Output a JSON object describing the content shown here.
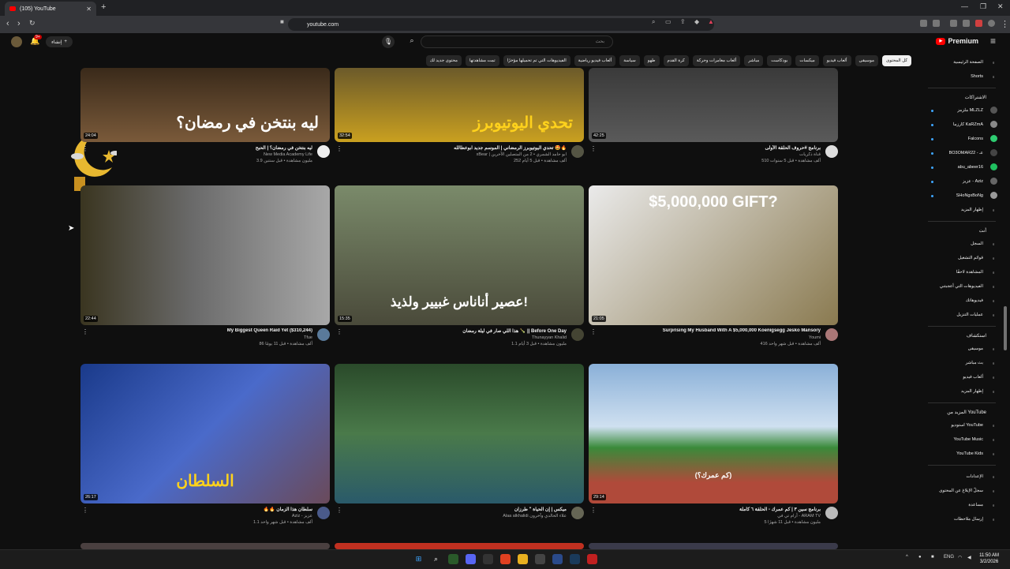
{
  "browser": {
    "tab_title": "(105) YouTube",
    "new_tab": "+",
    "url": "youtube.com",
    "win_controls": [
      "—",
      "❐",
      "✕"
    ]
  },
  "header": {
    "logo": "Premium",
    "search_placeholder": "بحث",
    "create_label": "إنشاء",
    "notif_count": "9+"
  },
  "chips": [
    {
      "label": "كل المحتوى",
      "active": true
    },
    {
      "label": "موسيقى"
    },
    {
      "label": "ألعاب فيديو"
    },
    {
      "label": "ميكسات"
    },
    {
      "label": "بودكاست"
    },
    {
      "label": "مباشر"
    },
    {
      "label": "ألعاب مغامرات وحركة"
    },
    {
      "label": "كرة القدم"
    },
    {
      "label": "طهو"
    },
    {
      "label": "سياسة"
    },
    {
      "label": "ألعاب فيديو رياضية"
    },
    {
      "label": "الفيديوهات التي تم تحميلها مؤخرًا"
    },
    {
      "label": "تمت مشاهدتها"
    },
    {
      "label": "محتوى جديد لك"
    }
  ],
  "sidebar": {
    "main": [
      {
        "label": "الصفحة الرئيسية",
        "icon": "home-icon"
      },
      {
        "label": "Shorts",
        "icon": "shorts-icon"
      }
    ],
    "subs_title": "الاشتراكات",
    "subs": [
      {
        "label": "ملزمز MLZLZ",
        "color": "#555"
      },
      {
        "label": "كارزما KaRZmA",
        "color": "#888"
      },
      {
        "label": "Falcons",
        "color": "#2ecc71"
      },
      {
        "label": "BO3OMAR22 - عـ",
        "color": "#444"
      },
      {
        "label": "abu_abeer16",
        "color": "#20c060"
      },
      {
        "label": "عزيز - Aziz",
        "color": "#666"
      },
      {
        "label": "SHoNgxBoNg",
        "color": "#999"
      }
    ],
    "subs_more": "إظهار المزيد",
    "you_title": "أنت",
    "you": [
      {
        "label": "السجل",
        "icon": "history-icon"
      },
      {
        "label": "قوائم التشغيل",
        "icon": "playlist-icon"
      },
      {
        "label": "المشاهدة لاحقًا",
        "icon": "clock-icon"
      },
      {
        "label": "الفيديوهات التي أعجبتني",
        "icon": "like-icon"
      },
      {
        "label": "فيديوهاتك",
        "icon": "video-icon"
      },
      {
        "label": "عمليات التنزيل",
        "icon": "download-icon"
      }
    ],
    "explore_title": "استكشاف",
    "explore": [
      {
        "label": "موسيقى",
        "icon": "music-icon"
      },
      {
        "label": "بث مباشر",
        "icon": "live-icon"
      },
      {
        "label": "ألعاب فيديو",
        "icon": "gaming-icon"
      },
      {
        "label": "إظهار المزيد",
        "icon": "chevron-down-icon"
      }
    ],
    "more_title": "المزيد من YouTube",
    "more": [
      {
        "label": "استوديو YouTube",
        "icon": "studio-icon"
      },
      {
        "label": "YouTube Music",
        "icon": "ytmusic-icon"
      },
      {
        "label": "YouTube Kids",
        "icon": "ytkids-icon"
      }
    ],
    "settings": [
      {
        "label": "الإعدادات",
        "icon": "gear-icon"
      },
      {
        "label": "سجلّ الإبلاغ عن المحتوى",
        "icon": "flag-icon"
      },
      {
        "label": "مساعدة",
        "icon": "help-icon"
      },
      {
        "label": "إرسال ملاحظات",
        "icon": "feedback-icon"
      }
    ]
  },
  "videos": [
    {
      "title": "برنامج #حروف الحلقة الأولى",
      "channel": "قناة ذكريات",
      "stats": "510 ألف مشاهدة • قبل 5 سنوات",
      "duration": "42:25",
      "thumb_text": "",
      "bg": "linear-gradient(180deg,#3a3a3a,#5a5a5a)",
      "accent": "#e8c020"
    },
    {
      "title": "تحدي اليوتيوبرز الرمضاني | الموسم جديد ابوعطالله 🤩🔥",
      "channel": "xBear | ابو حامد الشمري • 2 من المتصلين الآخرين",
      "stats": "252 ألف مشاهدة • قبل 5 أيام",
      "duration": "32:54",
      "thumb_text": "تحدي اليوتيوبرز",
      "bg": "linear-gradient(180deg,#6b5a2a,#c9a020)",
      "accent": "#ffd21c"
    },
    {
      "title": "ليه بنتخن في رمضان؟ | الحبح",
      "channel": "New Media Academy Life",
      "stats": "3.9 مليون مشاهدة • قبل سنتين",
      "duration": "24:04",
      "thumb_text": "ليه بنتخن في رمضان؟",
      "bg": "linear-gradient(180deg,#3a2a1a,#7a5a3a)",
      "accent": "#ffffff"
    },
    {
      "title": "Surprising My Husband With A $5,000,000 Koenigsegg Jesko Mansory",
      "channel": "Youmi",
      "stats": "416 ألف مشاهدة • قبل شهر واحد",
      "duration": "21:05",
      "thumb_text": "$5,000,000 GIFT?",
      "bg": "linear-gradient(135deg,#eaeaea,#8a7a50)",
      "accent": "#ffffff"
    },
    {
      "title": "هذا اللي صار في ليلة رمضان 🍾 || Before One Day",
      "channel": "Thunayyan Khalid",
      "stats": "1.1 مليون مشاهدة • قبل 3 أيام",
      "duration": "15:35",
      "thumb_text": "عصير أناناس غبيير ولذيذ!",
      "bg": "linear-gradient(180deg,#7a8a6a,#4a4a3a)",
      "accent": "#ffffff"
    },
    {
      "title": "My Biggest Queen Raid Yet ($310,244)",
      "channel": "Tfue",
      "stats": "86 ألف مشاهدة • قبل 11 يومًا",
      "duration": "22:44",
      "thumb_text": "",
      "bg": "linear-gradient(90deg,#3a3520,#6a6a6a 45%,#a8a8a8)",
      "accent": "#ffffff"
    },
    {
      "title": "برنامج سين ٣ | كم عمرك - الحلقة ٦ كاملة",
      "channel": "أرام تي في - ARAM TV",
      "stats": "5 مليون مشاهدة • قبل 11 شهرًا",
      "duration": "29:14",
      "thumb_text": "(كم عمرك؟)",
      "bg": "linear-gradient(180deg,#8ab0d8 0%,#cfe0f0 45%,#3a8a3a 60%,#b04a3a 85%)",
      "accent": "#ffffff"
    },
    {
      "title": "ميكس | إن الحياة \" طرزان",
      "channel": "Alaa alkhalidi علاء الخالدي وآخرون",
      "stats": "",
      "duration": "",
      "thumb_text": "",
      "bg": "linear-gradient(180deg,#2a4a2a,#4a7a4a 50%,#2a5a6a)",
      "accent": "#ffffff"
    },
    {
      "title": "🔥🔥 سلطان هذا الزمان",
      "channel": "Aziz - عزيز",
      "stats": "1.1 ألف مشاهدة • قبل شهر واحد",
      "duration": "26:17",
      "thumb_text": "السلطان",
      "bg": "linear-gradient(135deg,#1a3a8a,#4a6aca 50%,#6a4a5a)",
      "accent": "#ffd21c"
    }
  ],
  "taskbar": {
    "lang": "ENG",
    "time": "11:50 AM",
    "date": "3/2/2026"
  }
}
